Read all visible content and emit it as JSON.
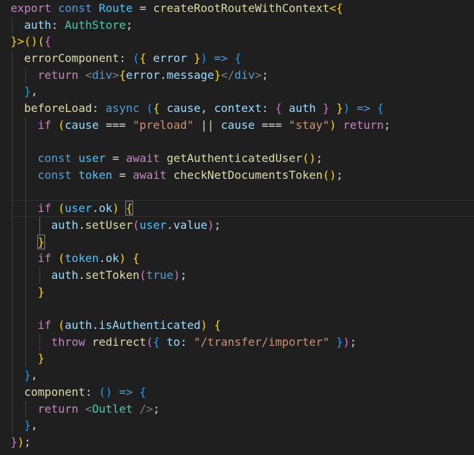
{
  "editor": {
    "lines": [
      {
        "indent": 0,
        "tokens": [
          {
            "t": "export",
            "c": "control"
          },
          {
            "t": " ",
            "c": "punct"
          },
          {
            "t": "const",
            "c": "keyword"
          },
          {
            "t": " ",
            "c": "punct"
          },
          {
            "t": "Route",
            "c": "const"
          },
          {
            "t": " = ",
            "c": "punct"
          },
          {
            "t": "createRootRouteWithContext",
            "c": "func"
          },
          {
            "t": "<{",
            "c": "b1"
          }
        ]
      },
      {
        "indent": 1,
        "tokens": [
          {
            "t": "auth",
            "c": "var"
          },
          {
            "t": ": ",
            "c": "punct"
          },
          {
            "t": "AuthStore",
            "c": "type"
          },
          {
            "t": ";",
            "c": "punct"
          }
        ]
      },
      {
        "indent": 0,
        "tokens": [
          {
            "t": "}>",
            "c": "b1"
          },
          {
            "t": "()",
            "c": "b1"
          },
          {
            "t": "(",
            "c": "b1"
          },
          {
            "t": "{",
            "c": "b2"
          }
        ]
      },
      {
        "indent": 1,
        "tokens": [
          {
            "t": "errorComponent",
            "c": "func"
          },
          {
            "t": ": ",
            "c": "punct"
          },
          {
            "t": "(",
            "c": "b3"
          },
          {
            "t": "{",
            "c": "b1"
          },
          {
            "t": " ",
            "c": "punct"
          },
          {
            "t": "error",
            "c": "var"
          },
          {
            "t": " ",
            "c": "punct"
          },
          {
            "t": "}",
            "c": "b1"
          },
          {
            "t": ")",
            "c": "b3"
          },
          {
            "t": " ",
            "c": "punct"
          },
          {
            "t": "=>",
            "c": "keyword"
          },
          {
            "t": " ",
            "c": "punct"
          },
          {
            "t": "{",
            "c": "b3"
          }
        ]
      },
      {
        "indent": 2,
        "tokens": [
          {
            "t": "return",
            "c": "control"
          },
          {
            "t": " ",
            "c": "punct"
          },
          {
            "t": "<",
            "c": "tag"
          },
          {
            "t": "div",
            "c": "keyword"
          },
          {
            "t": ">",
            "c": "tag"
          },
          {
            "t": "{",
            "c": "b1"
          },
          {
            "t": "error",
            "c": "var"
          },
          {
            "t": ".",
            "c": "punct"
          },
          {
            "t": "message",
            "c": "var"
          },
          {
            "t": "}",
            "c": "b1"
          },
          {
            "t": "</",
            "c": "tag"
          },
          {
            "t": "div",
            "c": "keyword"
          },
          {
            "t": ">",
            "c": "tag"
          },
          {
            "t": ";",
            "c": "punct"
          }
        ]
      },
      {
        "indent": 1,
        "tokens": [
          {
            "t": "}",
            "c": "b3"
          },
          {
            "t": ",",
            "c": "punct"
          }
        ]
      },
      {
        "indent": 1,
        "tokens": [
          {
            "t": "beforeLoad",
            "c": "func"
          },
          {
            "t": ": ",
            "c": "punct"
          },
          {
            "t": "async",
            "c": "keyword"
          },
          {
            "t": " ",
            "c": "punct"
          },
          {
            "t": "(",
            "c": "b3"
          },
          {
            "t": "{",
            "c": "b1"
          },
          {
            "t": " ",
            "c": "punct"
          },
          {
            "t": "cause",
            "c": "var"
          },
          {
            "t": ", ",
            "c": "punct"
          },
          {
            "t": "context",
            "c": "var"
          },
          {
            "t": ": ",
            "c": "punct"
          },
          {
            "t": "{",
            "c": "b2"
          },
          {
            "t": " ",
            "c": "punct"
          },
          {
            "t": "auth",
            "c": "var"
          },
          {
            "t": " ",
            "c": "punct"
          },
          {
            "t": "}",
            "c": "b2"
          },
          {
            "t": " ",
            "c": "punct"
          },
          {
            "t": "}",
            "c": "b1"
          },
          {
            "t": ")",
            "c": "b3"
          },
          {
            "t": " ",
            "c": "punct"
          },
          {
            "t": "=>",
            "c": "keyword"
          },
          {
            "t": " ",
            "c": "punct"
          },
          {
            "t": "{",
            "c": "b3"
          }
        ]
      },
      {
        "indent": 2,
        "tokens": [
          {
            "t": "if",
            "c": "control"
          },
          {
            "t": " ",
            "c": "punct"
          },
          {
            "t": "(",
            "c": "b1"
          },
          {
            "t": "cause",
            "c": "var"
          },
          {
            "t": " === ",
            "c": "punct"
          },
          {
            "t": "\"preload\"",
            "c": "string"
          },
          {
            "t": " || ",
            "c": "punct"
          },
          {
            "t": "cause",
            "c": "var"
          },
          {
            "t": " === ",
            "c": "punct"
          },
          {
            "t": "\"stay\"",
            "c": "string"
          },
          {
            "t": ")",
            "c": "b1"
          },
          {
            "t": " ",
            "c": "punct"
          },
          {
            "t": "return",
            "c": "control"
          },
          {
            "t": ";",
            "c": "punct"
          }
        ]
      },
      {
        "indent": 2,
        "tokens": []
      },
      {
        "indent": 2,
        "tokens": [
          {
            "t": "const",
            "c": "keyword"
          },
          {
            "t": " ",
            "c": "punct"
          },
          {
            "t": "user",
            "c": "const"
          },
          {
            "t": " = ",
            "c": "punct"
          },
          {
            "t": "await",
            "c": "control"
          },
          {
            "t": " ",
            "c": "punct"
          },
          {
            "t": "getAuthenticatedUser",
            "c": "func"
          },
          {
            "t": "()",
            "c": "b1"
          },
          {
            "t": ";",
            "c": "punct"
          }
        ]
      },
      {
        "indent": 2,
        "tokens": [
          {
            "t": "const",
            "c": "keyword"
          },
          {
            "t": " ",
            "c": "punct"
          },
          {
            "t": "token",
            "c": "const"
          },
          {
            "t": " = ",
            "c": "punct"
          },
          {
            "t": "await",
            "c": "control"
          },
          {
            "t": " ",
            "c": "punct"
          },
          {
            "t": "checkNetDocumentsToken",
            "c": "func"
          },
          {
            "t": "()",
            "c": "b1"
          },
          {
            "t": ";",
            "c": "punct"
          }
        ]
      },
      {
        "indent": 2,
        "tokens": []
      },
      {
        "indent": 2,
        "current": true,
        "tokens": [
          {
            "t": "if",
            "c": "control"
          },
          {
            "t": " ",
            "c": "punct"
          },
          {
            "t": "(",
            "c": "b1"
          },
          {
            "t": "user",
            "c": "const"
          },
          {
            "t": ".",
            "c": "punct"
          },
          {
            "t": "ok",
            "c": "var"
          },
          {
            "t": ")",
            "c": "b1"
          },
          {
            "t": " ",
            "c": "punct"
          },
          {
            "t": "{",
            "c": "b1",
            "m": true
          }
        ]
      },
      {
        "indent": 3,
        "activeGuide": 2,
        "tokens": [
          {
            "t": "auth",
            "c": "var"
          },
          {
            "t": ".",
            "c": "punct"
          },
          {
            "t": "setUser",
            "c": "func"
          },
          {
            "t": "(",
            "c": "b2"
          },
          {
            "t": "user",
            "c": "const"
          },
          {
            "t": ".",
            "c": "punct"
          },
          {
            "t": "value",
            "c": "var"
          },
          {
            "t": ")",
            "c": "b2"
          },
          {
            "t": ";",
            "c": "punct"
          }
        ]
      },
      {
        "indent": 2,
        "tokens": [
          {
            "t": "}",
            "c": "b1",
            "m": true
          }
        ]
      },
      {
        "indent": 2,
        "tokens": [
          {
            "t": "if",
            "c": "control"
          },
          {
            "t": " ",
            "c": "punct"
          },
          {
            "t": "(",
            "c": "b1"
          },
          {
            "t": "token",
            "c": "const"
          },
          {
            "t": ".",
            "c": "punct"
          },
          {
            "t": "ok",
            "c": "var"
          },
          {
            "t": ")",
            "c": "b1"
          },
          {
            "t": " ",
            "c": "punct"
          },
          {
            "t": "{",
            "c": "b1"
          }
        ]
      },
      {
        "indent": 3,
        "tokens": [
          {
            "t": "auth",
            "c": "var"
          },
          {
            "t": ".",
            "c": "punct"
          },
          {
            "t": "setToken",
            "c": "func"
          },
          {
            "t": "(",
            "c": "b2"
          },
          {
            "t": "true",
            "c": "keyword"
          },
          {
            "t": ")",
            "c": "b2"
          },
          {
            "t": ";",
            "c": "punct"
          }
        ]
      },
      {
        "indent": 2,
        "tokens": [
          {
            "t": "}",
            "c": "b1"
          }
        ]
      },
      {
        "indent": 2,
        "tokens": []
      },
      {
        "indent": 2,
        "tokens": [
          {
            "t": "if",
            "c": "control"
          },
          {
            "t": " ",
            "c": "punct"
          },
          {
            "t": "(",
            "c": "b1"
          },
          {
            "t": "auth",
            "c": "var"
          },
          {
            "t": ".",
            "c": "punct"
          },
          {
            "t": "isAuthenticated",
            "c": "var"
          },
          {
            "t": ")",
            "c": "b1"
          },
          {
            "t": " ",
            "c": "punct"
          },
          {
            "t": "{",
            "c": "b1"
          }
        ]
      },
      {
        "indent": 3,
        "tokens": [
          {
            "t": "throw",
            "c": "control"
          },
          {
            "t": " ",
            "c": "punct"
          },
          {
            "t": "redirect",
            "c": "func"
          },
          {
            "t": "(",
            "c": "b2"
          },
          {
            "t": "{",
            "c": "b3"
          },
          {
            "t": " ",
            "c": "punct"
          },
          {
            "t": "to",
            "c": "var"
          },
          {
            "t": ": ",
            "c": "punct"
          },
          {
            "t": "\"/transfer/importer\"",
            "c": "string"
          },
          {
            "t": " ",
            "c": "punct"
          },
          {
            "t": "}",
            "c": "b3"
          },
          {
            "t": ")",
            "c": "b2"
          },
          {
            "t": ";",
            "c": "punct"
          }
        ]
      },
      {
        "indent": 2,
        "tokens": [
          {
            "t": "}",
            "c": "b1"
          }
        ]
      },
      {
        "indent": 1,
        "tokens": [
          {
            "t": "}",
            "c": "b3"
          },
          {
            "t": ",",
            "c": "punct"
          }
        ]
      },
      {
        "indent": 1,
        "tokens": [
          {
            "t": "component",
            "c": "func"
          },
          {
            "t": ": ",
            "c": "punct"
          },
          {
            "t": "()",
            "c": "b3"
          },
          {
            "t": " ",
            "c": "punct"
          },
          {
            "t": "=>",
            "c": "keyword"
          },
          {
            "t": " ",
            "c": "punct"
          },
          {
            "t": "{",
            "c": "b3"
          }
        ]
      },
      {
        "indent": 2,
        "tokens": [
          {
            "t": "return",
            "c": "control"
          },
          {
            "t": " ",
            "c": "punct"
          },
          {
            "t": "<",
            "c": "tag"
          },
          {
            "t": "Outlet",
            "c": "type"
          },
          {
            "t": " />",
            "c": "tag"
          },
          {
            "t": ";",
            "c": "punct"
          }
        ]
      },
      {
        "indent": 1,
        "tokens": [
          {
            "t": "}",
            "c": "b3"
          },
          {
            "t": ",",
            "c": "punct"
          }
        ]
      },
      {
        "indent": 0,
        "tokens": [
          {
            "t": "}",
            "c": "b2"
          },
          {
            "t": ")",
            "c": "b1"
          },
          {
            "t": ";",
            "c": "punct"
          }
        ]
      }
    ]
  }
}
